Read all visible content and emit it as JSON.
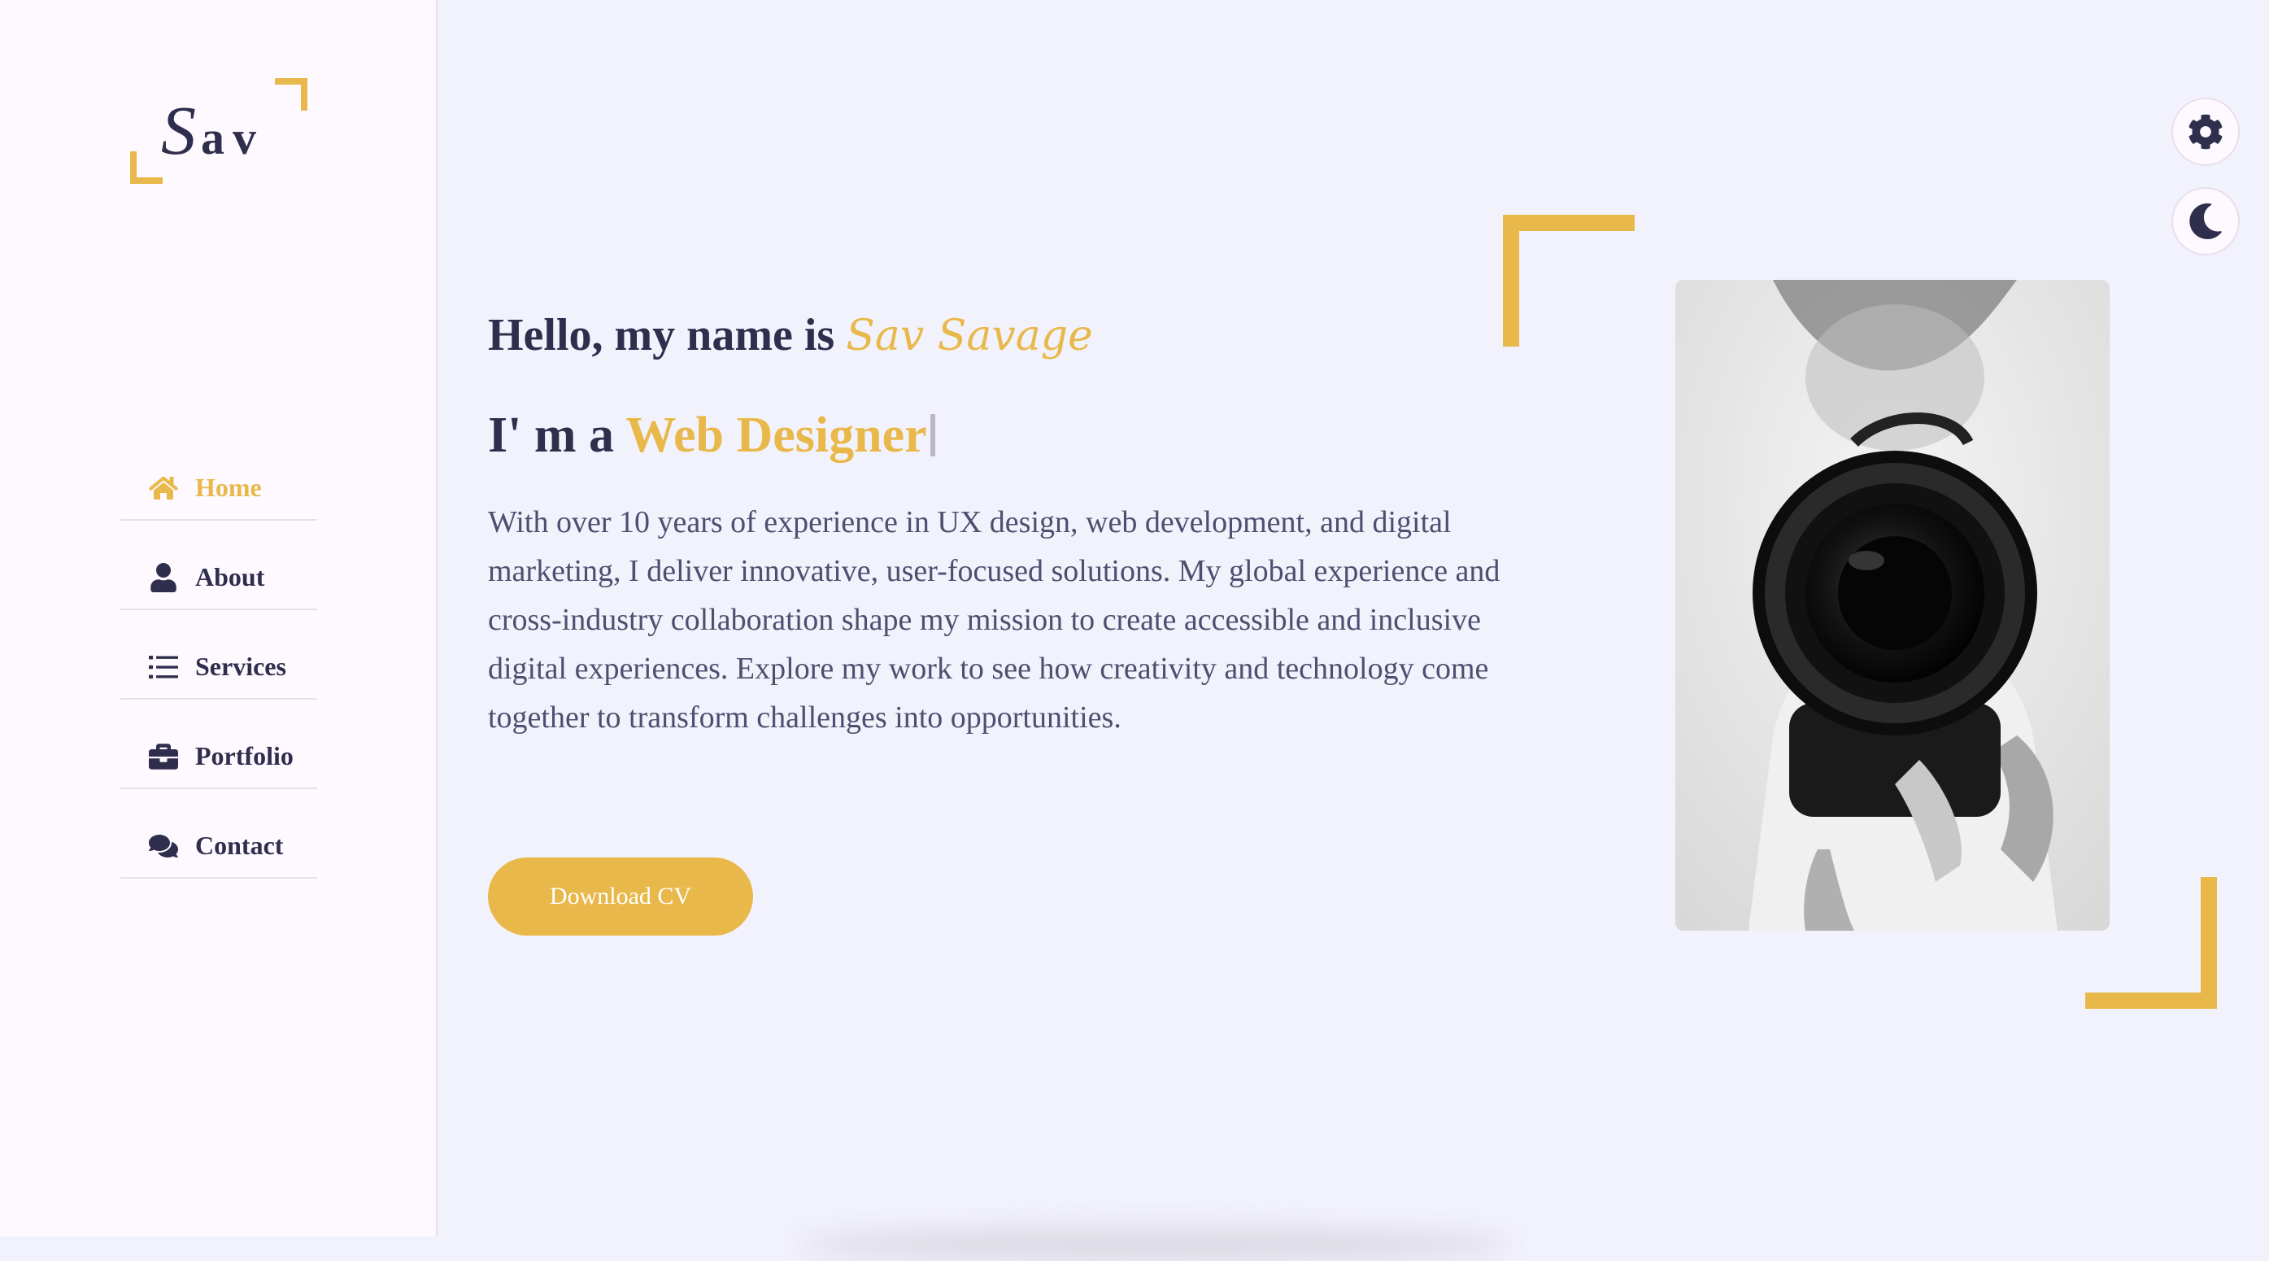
{
  "logo": {
    "first_letter": "S",
    "rest": "av"
  },
  "nav": {
    "items": [
      {
        "label": "Home",
        "icon": "home-icon",
        "active": true
      },
      {
        "label": "About",
        "icon": "user-icon",
        "active": false
      },
      {
        "label": "Services",
        "icon": "list-icon",
        "active": false
      },
      {
        "label": "Portfolio",
        "icon": "briefcase-icon",
        "active": false
      },
      {
        "label": "Contact",
        "icon": "comments-icon",
        "active": false
      }
    ]
  },
  "hero": {
    "greeting_prefix": "Hello, my name is",
    "name": "Sav Savage",
    "role_prefix": "I' m a",
    "role": "Web Designer",
    "bio": "With over 10 years of experience in UX design, web development, and digital marketing, I deliver innovative, user-focused solutions. My global experience and cross-industry collaboration shape my mission to create accessible and inclusive digital experiences. Explore my work to see how creativity and technology come together to transform challenges into opportunities.",
    "download_label": "Download CV"
  },
  "controls": {
    "settings_icon": "gear-icon",
    "theme_icon": "moon-icon"
  },
  "colors": {
    "accent": "#e9b84a",
    "text_dark": "#302e4d",
    "background": "#f2f2fc",
    "sidebar_bg": "#fdf9ff"
  }
}
